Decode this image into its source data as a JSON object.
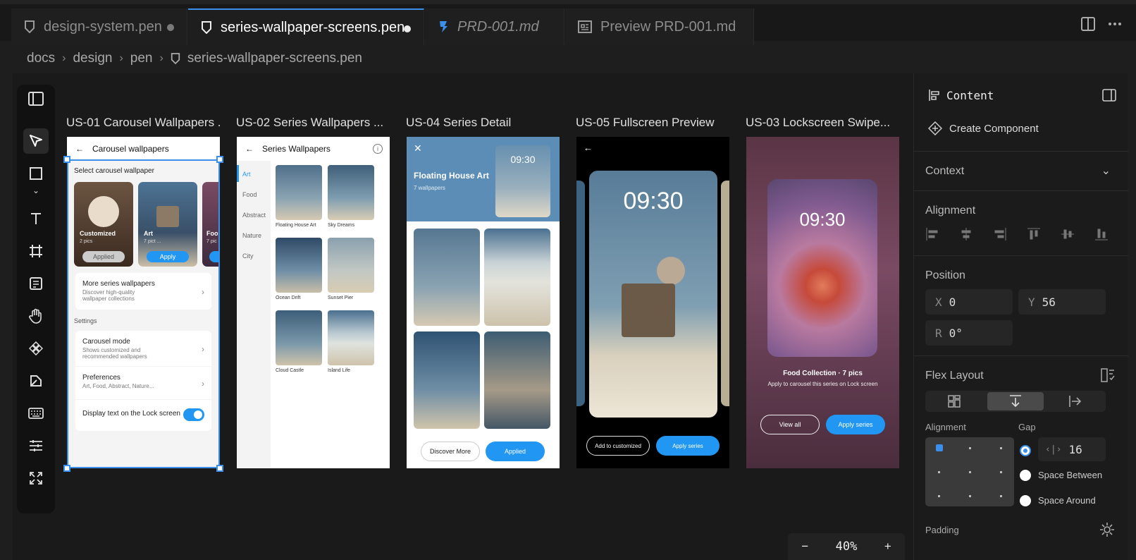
{
  "tabs": [
    {
      "label": "design-system.pen",
      "modified": true
    },
    {
      "label": "series-wallpaper-screens.pen",
      "modified": true,
      "active": true
    },
    {
      "label": "PRD-001.md"
    },
    {
      "label": "Preview PRD-001.md"
    }
  ],
  "breadcrumb": [
    "docs",
    "design",
    "pen",
    "series-wallpaper-screens.pen"
  ],
  "frames": [
    {
      "title": "US-01 Carousel Wallpapers ..."
    },
    {
      "title": "US-02 Series Wallpapers ..."
    },
    {
      "title": "US-04 Series Detail"
    },
    {
      "title": "US-05 Fullscreen Preview"
    },
    {
      "title": "US-03 Lockscreen Swipe..."
    }
  ],
  "f1": {
    "header": "Carousel wallpapers",
    "section": "Select carousel wallpaper",
    "tiles": [
      {
        "name": "Customized",
        "sub": "2 pics",
        "btn": "Applied"
      },
      {
        "name": "Art",
        "sub": "7 pict ...",
        "btn": "Apply"
      },
      {
        "name": "Foo",
        "sub": "7 pic"
      }
    ],
    "more_title": "More series wallpapers",
    "more_sub": "Discover high-quality wallpaper collections",
    "settings_label": "Settings",
    "carousel_mode": "Carousel mode",
    "carousel_mode_sub": "Shows customized and recommended wallpapers",
    "prefs": "Preferences",
    "prefs_sub": "Art, Food, Abstract, Nature...",
    "display_text": "Display text on the Lock screen"
  },
  "f2": {
    "header": "Series Wallpapers",
    "categories": [
      "Art",
      "Food",
      "Abstract",
      "Nature",
      "City"
    ],
    "items": [
      "Floating House Art",
      "Sky Dreams",
      "Ocean Drift",
      "Sunset Pier",
      "Cloud Castle",
      "Island Life"
    ]
  },
  "f3": {
    "title": "Floating House Art",
    "sub": "7 wallpapers",
    "time": "09:30",
    "btn1": "Discover More",
    "btn2": "Applied"
  },
  "f4": {
    "time": "09:30",
    "btn1": "Add to customized",
    "btn2": "Apply series"
  },
  "f5": {
    "time": "09:30",
    "title": "Food Collection · 7 pics",
    "sub": "Apply to carousel this series on Lock screen",
    "btn1": "View all",
    "btn2": "Apply series"
  },
  "panel": {
    "content": "Content",
    "create": "Create Component",
    "context": "Context",
    "alignment": "Alignment",
    "position": "Position",
    "x_label": "X",
    "x": "0",
    "y_label": "Y",
    "y": "56",
    "r_label": "R",
    "r": "0°",
    "flex": "Flex Layout",
    "flex_align": "Alignment",
    "gap_label": "Gap",
    "gap": "16",
    "space_between": "Space Between",
    "space_around": "Space Around",
    "padding": "Padding"
  },
  "zoom": "40%",
  "colors": {
    "accent": "#3b8eea",
    "blue_btn": "#2196f3"
  }
}
